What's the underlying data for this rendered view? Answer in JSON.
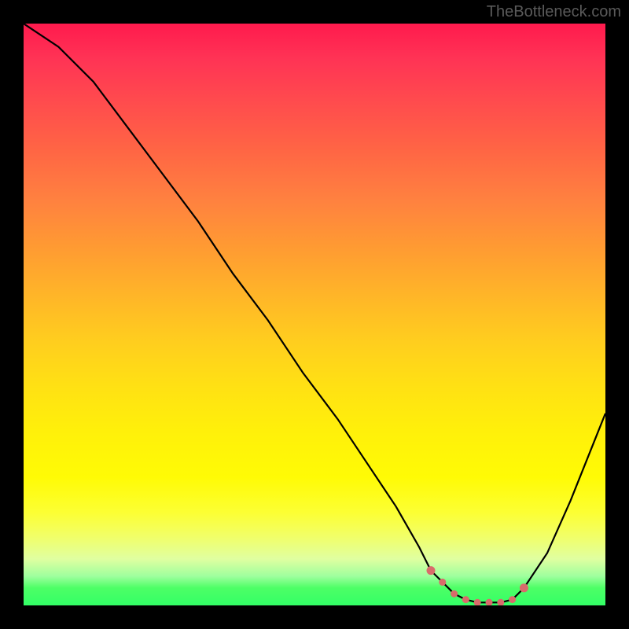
{
  "watermark": "TheBottleneck.com",
  "chart_data": {
    "type": "line",
    "title": "",
    "xlabel": "",
    "ylabel": "",
    "xlim": [
      0,
      100
    ],
    "ylim": [
      0,
      100
    ],
    "series": [
      {
        "name": "bottleneck-curve",
        "x": [
          0,
          6,
          12,
          18,
          24,
          30,
          36,
          42,
          48,
          54,
          60,
          64,
          68,
          70,
          72,
          74,
          76,
          78,
          80,
          82,
          84,
          86,
          90,
          94,
          98,
          100
        ],
        "y": [
          100,
          96,
          90,
          82,
          74,
          66,
          57,
          49,
          40,
          32,
          23,
          17,
          10,
          6,
          4,
          2,
          1,
          0.5,
          0.5,
          0.5,
          1,
          3,
          9,
          18,
          28,
          33
        ]
      }
    ],
    "markers": {
      "name": "optimal-range-dots",
      "x": [
        70,
        72,
        74,
        76,
        78,
        80,
        82,
        84,
        86
      ],
      "y": [
        6,
        4,
        2,
        1,
        0.5,
        0.5,
        0.5,
        1,
        3
      ],
      "color": "#d96b6b"
    },
    "gradient_stops": [
      {
        "pos": 0,
        "color": "#ff1a4d"
      },
      {
        "pos": 50,
        "color": "#ffcc1f"
      },
      {
        "pos": 85,
        "color": "#fcff33"
      },
      {
        "pos": 100,
        "color": "#33ff66"
      }
    ]
  }
}
